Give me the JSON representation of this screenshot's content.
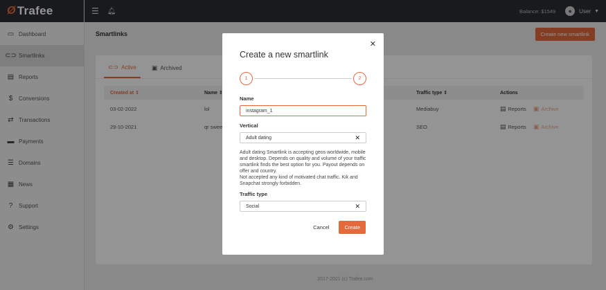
{
  "brand": {
    "name": "Trafee",
    "accent": "#e46a3d"
  },
  "sidebar": {
    "items": [
      {
        "label": "Dashboard",
        "icon": "dashboard-icon",
        "glyph": "▭"
      },
      {
        "label": "Smartlinks",
        "icon": "link-icon",
        "glyph": "⊂⊃"
      },
      {
        "label": "Reports",
        "icon": "report-icon",
        "glyph": "▤"
      },
      {
        "label": "Conversions",
        "icon": "dollar-icon",
        "glyph": "$"
      },
      {
        "label": "Transactions",
        "icon": "transfer-icon",
        "glyph": "⇄"
      },
      {
        "label": "Payments",
        "icon": "card-icon",
        "glyph": "▬"
      },
      {
        "label": "Domains",
        "icon": "server-icon",
        "glyph": "☰"
      },
      {
        "label": "News",
        "icon": "news-icon",
        "glyph": "▦"
      },
      {
        "label": "Support",
        "icon": "question-icon",
        "glyph": "?"
      },
      {
        "label": "Settings",
        "icon": "gear-icon",
        "glyph": "⚙"
      }
    ]
  },
  "topbar": {
    "balance": "Balance: $1549",
    "user": "User"
  },
  "page": {
    "title": "Smartlinks",
    "new_button": "Create new smartlink",
    "footer": "2017-2021 (c) Trafee.com"
  },
  "tabs": [
    {
      "label": "Active"
    },
    {
      "label": "Archived"
    }
  ],
  "table": {
    "headers": [
      "Created at",
      "Name",
      "Traffic type",
      "Actions"
    ],
    "rows": [
      {
        "created": "03-02-2022",
        "name": "lol",
        "traffic": "Mediabuy",
        "reports": "Reports",
        "archive": "Archive"
      },
      {
        "created": "29-10-2021",
        "name": "qr swee",
        "traffic": "SEO",
        "reports": "Reports",
        "archive": "Archive"
      }
    ]
  },
  "modal": {
    "title": "Create a new smartlink",
    "steps": [
      "1",
      "2"
    ],
    "name_label": "Name",
    "name_value": "instagram_1",
    "vertical_label": "Vertical",
    "vertical_value": "Adult dating",
    "description": "Adult dating Smartlink is accepting geos worldwide, mobile and desktop. Depends on quality and volume of your traffic smartlink finds the best option for you. Payout depends on offer and country.",
    "note": "Not accepted any kind of motivated chat traffic. Kik and Snapchat strongly forbidden.",
    "traffic_label": "Traffic type",
    "traffic_value": "Social",
    "cancel": "Cancel",
    "create": "Create"
  }
}
